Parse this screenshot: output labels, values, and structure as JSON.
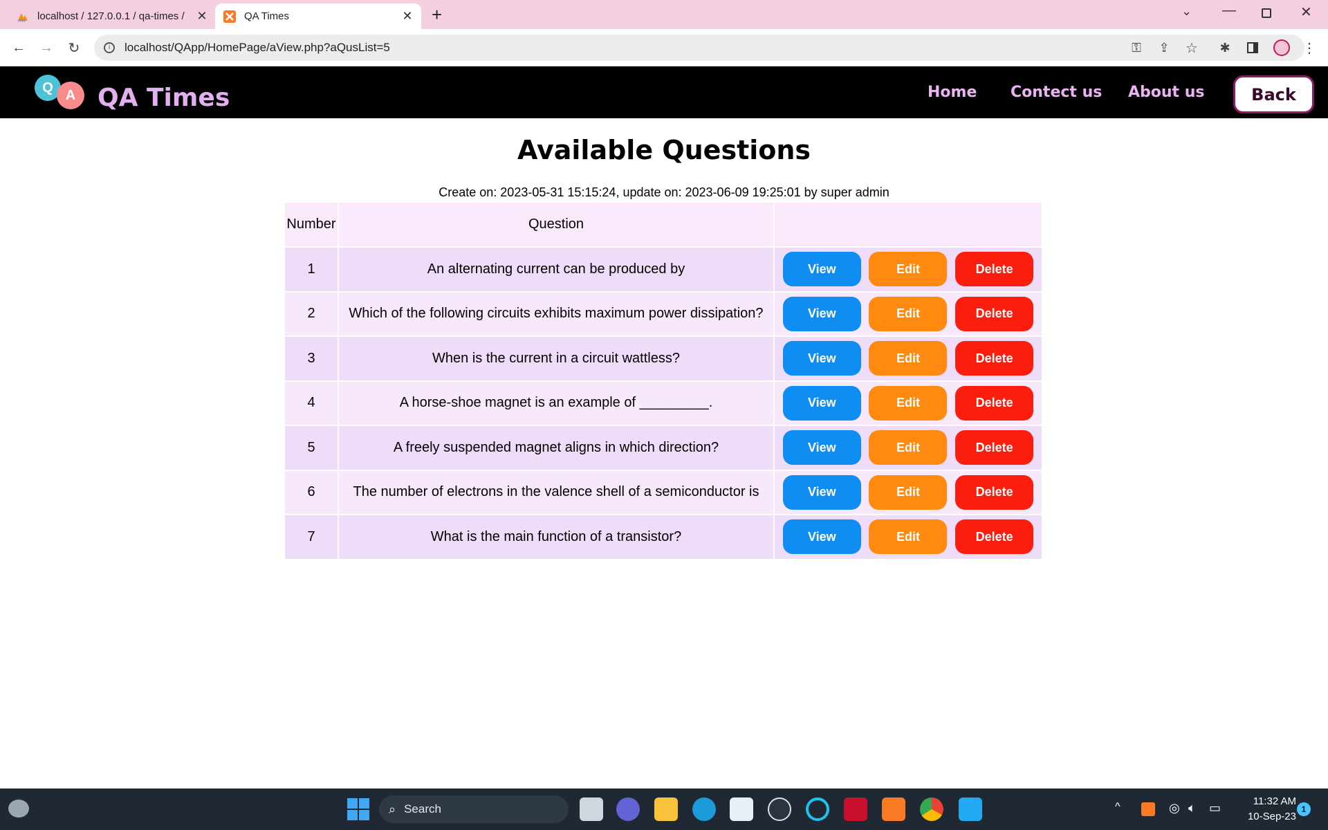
{
  "browser": {
    "tabs": [
      {
        "title": "localhost / 127.0.0.1 / qa-times / "
      },
      {
        "title": "QA Times"
      }
    ],
    "url": "localhost/QApp/HomePage/aView.php?aQusList=5"
  },
  "site": {
    "brand": "QA Times",
    "logo_letters": [
      "Q",
      "A"
    ],
    "nav": [
      "Home",
      "Contect us",
      "About us"
    ],
    "back_label": "Back"
  },
  "page": {
    "title": "Available Questions",
    "meta": "Create on: 2023-05-31 15:15:24, update on: 2023-06-09 19:25:01 by super admin"
  },
  "table": {
    "headers": {
      "number": "Number",
      "question": "Question"
    },
    "rows": [
      {
        "number": "1",
        "question": "An alternating current can be produced by"
      },
      {
        "number": "2",
        "question": "Which of the following circuits exhibits maximum power dissipation?"
      },
      {
        "number": "3",
        "question": "When is the current in a circuit wattless?"
      },
      {
        "number": "4",
        "question": "A horse-shoe magnet is an example of _________."
      },
      {
        "number": "5",
        "question": "A freely suspended magnet aligns in which direction?"
      },
      {
        "number": "6",
        "question": "The number of electrons in the valence shell of a semiconductor is"
      },
      {
        "number": "7",
        "question": "What is the main function of a transistor?"
      }
    ],
    "actions": {
      "view": "View",
      "edit": "Edit",
      "delete": "Delete"
    }
  },
  "taskbar": {
    "search_label": "Search",
    "time": "11:32 AM",
    "date": "10-Sep-23",
    "notification_count": "1"
  },
  "colors": {
    "view": "#0e8ef2",
    "edit": "#ff8a0f",
    "delete": "#fb1d0e",
    "brand": "#e2b0ef",
    "tabstrip": "#f4cfe0"
  }
}
